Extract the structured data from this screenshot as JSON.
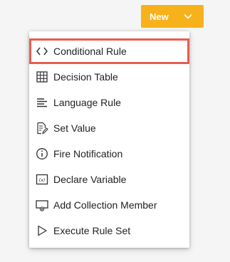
{
  "header": {
    "new_button_label": "New",
    "new_button_icon": "chevron-down-icon",
    "accent_color": "#f7b21b"
  },
  "menu": {
    "items": [
      {
        "label": "Conditional Rule",
        "icon": "code-brackets-icon",
        "highlighted": true
      },
      {
        "label": "Decision Table",
        "icon": "table-grid-icon",
        "highlighted": false
      },
      {
        "label": "Language Rule",
        "icon": "text-lines-icon",
        "highlighted": false
      },
      {
        "label": "Set Value",
        "icon": "edit-document-icon",
        "highlighted": false
      },
      {
        "label": "Fire Notification",
        "icon": "info-circle-icon",
        "highlighted": false
      },
      {
        "label": "Declare Variable",
        "icon": "variable-box-icon",
        "highlighted": false
      },
      {
        "label": "Add Collection Member",
        "icon": "add-to-collection-icon",
        "highlighted": false
      },
      {
        "label": "Execute Rule Set",
        "icon": "play-triangle-icon",
        "highlighted": false
      }
    ],
    "highlight_color": "#e85c4f"
  }
}
